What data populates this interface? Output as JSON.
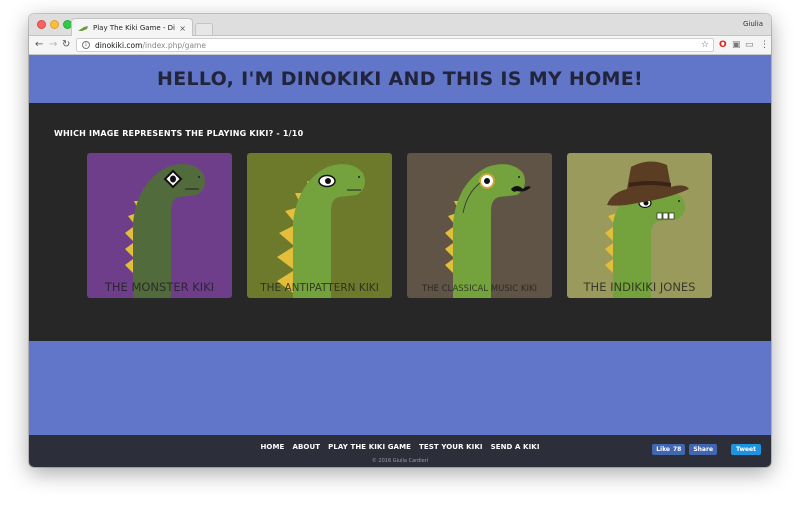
{
  "browser": {
    "tab_title": "Play The Kiki Game - Dinok",
    "tab_close": "×",
    "profile": "Giulia",
    "url_host": "dinokiki.com",
    "url_path": "/index.php/game",
    "info_glyph": "i"
  },
  "page": {
    "title": "HELLO, I'M DINOKIKI AND THIS IS MY HOME!",
    "question": "WHICH IMAGE REPRESENTS THE PLAYING KIKI? - 1/10",
    "cards": [
      {
        "label": "THE MONSTER KIKI",
        "bg": "#6f3e8a"
      },
      {
        "label": "THE ANTIPATTERN KIKI",
        "bg": "#6d7a2c"
      },
      {
        "label": "THE CLASSICAL MUSIC KIKI",
        "bg": "#5f5445"
      },
      {
        "label": "THE INDIKIKI JONES",
        "bg": "#9a9a5c"
      }
    ]
  },
  "footer": {
    "nav": [
      "HOME",
      "ABOUT",
      "PLAY THE KIKI GAME",
      "TEST YOUR KIKI",
      "SEND A KIKI"
    ],
    "copyright": "© 2016 Giulia Cardieri",
    "like_label": "Like",
    "like_count": "78",
    "share_label": "Share",
    "tweet_label": "Tweet"
  },
  "colors": {
    "header": "#6176c8",
    "game_band": "#272727",
    "footer": "#2c2f3a",
    "dino_green": "#6a9a3a",
    "spikes": "#e3be3a"
  },
  "icons": [
    "back-arrow-icon",
    "forward-arrow-icon",
    "reload-icon",
    "info-icon",
    "star-icon",
    "opera-icon",
    "extension-icon",
    "cast-icon",
    "menu-icon"
  ]
}
